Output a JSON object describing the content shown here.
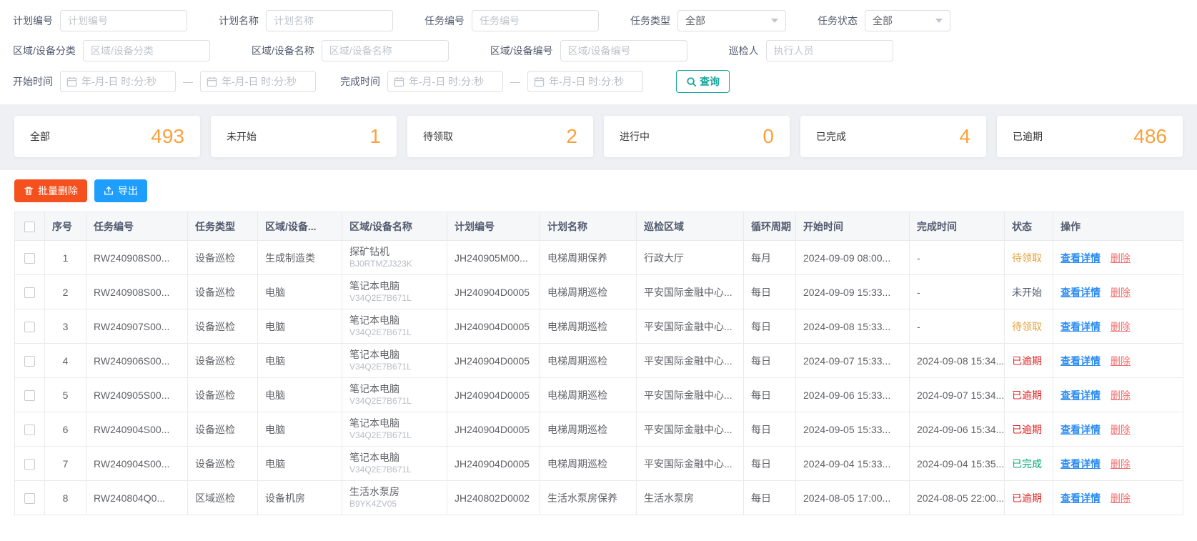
{
  "filters": {
    "plan_no": {
      "label": "计划编号",
      "placeholder": "计划编号"
    },
    "plan_name": {
      "label": "计划名称",
      "placeholder": "计划名称"
    },
    "task_no": {
      "label": "任务编号",
      "placeholder": "任务编号"
    },
    "task_type": {
      "label": "任务类型",
      "value": "全部"
    },
    "task_status": {
      "label": "任务状态",
      "value": "全部"
    },
    "area_category": {
      "label": "区域/设备分类",
      "placeholder": "区域/设备分类"
    },
    "area_name": {
      "label": "区域/设备名称",
      "placeholder": "区域/设备名称"
    },
    "area_no": {
      "label": "区域/设备编号",
      "placeholder": "区域/设备编号"
    },
    "inspector": {
      "label": "巡检人",
      "placeholder": "执行人员"
    },
    "start_time_label": "开始时间",
    "finish_time_label": "完成时间",
    "datetime_placeholder": "年-月-日 时:分:秒",
    "range_separator": "—",
    "search_button": "查询"
  },
  "stats": {
    "cards": [
      {
        "label": "全部",
        "value": "493"
      },
      {
        "label": "未开始",
        "value": "1"
      },
      {
        "label": "待领取",
        "value": "2"
      },
      {
        "label": "进行中",
        "value": "0"
      },
      {
        "label": "已完成",
        "value": "4"
      },
      {
        "label": "已逾期",
        "value": "486"
      }
    ]
  },
  "toolbar": {
    "batch_delete": "批量删除",
    "export": "导出"
  },
  "table": {
    "headers": [
      "序号",
      "任务编号",
      "任务类型",
      "区域/设备...",
      "区域/设备名称",
      "计划编号",
      "计划名称",
      "巡检区域",
      "循环周期",
      "开始时间",
      "完成时间",
      "状态",
      "操作"
    ],
    "action_view": "查看详情",
    "action_delete": "删除",
    "rows": [
      {
        "seq": "1",
        "task_no": "RW240908S00...",
        "task_type": "设备巡检",
        "device_category": "生成制造类",
        "device_name": "探矿钻机",
        "device_code": "BJ0RTMZJ323K",
        "plan_no": "JH240905M00...",
        "plan_name": "电梯周期保养",
        "area": "行政大厅",
        "cycle": "每月",
        "start": "2024-09-09 08:00...",
        "finish": "-",
        "status": "待领取",
        "status_class": "st-pending"
      },
      {
        "seq": "2",
        "task_no": "RW240908S00...",
        "task_type": "设备巡检",
        "device_category": "电脑",
        "device_name": "笔记本电脑",
        "device_code": "V34Q2E7B671L",
        "plan_no": "JH240904D0005",
        "plan_name": "电梯周期巡检",
        "area": "平安国际金融中心...",
        "cycle": "每日",
        "start": "2024-09-09 15:33...",
        "finish": "-",
        "status": "未开始",
        "status_class": "st-notstart"
      },
      {
        "seq": "3",
        "task_no": "RW240907S00...",
        "task_type": "设备巡检",
        "device_category": "电脑",
        "device_name": "笔记本电脑",
        "device_code": "V34Q2E7B671L",
        "plan_no": "JH240904D0005",
        "plan_name": "电梯周期巡检",
        "area": "平安国际金融中心...",
        "cycle": "每日",
        "start": "2024-09-08 15:33...",
        "finish": "-",
        "status": "待领取",
        "status_class": "st-pending"
      },
      {
        "seq": "4",
        "task_no": "RW240906S00...",
        "task_type": "设备巡检",
        "device_category": "电脑",
        "device_name": "笔记本电脑",
        "device_code": "V34Q2E7B671L",
        "plan_no": "JH240904D0005",
        "plan_name": "电梯周期巡检",
        "area": "平安国际金融中心...",
        "cycle": "每日",
        "start": "2024-09-07 15:33...",
        "finish": "2024-09-08 15:34...",
        "status": "已逾期",
        "status_class": "st-overdue"
      },
      {
        "seq": "5",
        "task_no": "RW240905S00...",
        "task_type": "设备巡检",
        "device_category": "电脑",
        "device_name": "笔记本电脑",
        "device_code": "V34Q2E7B671L",
        "plan_no": "JH240904D0005",
        "plan_name": "电梯周期巡检",
        "area": "平安国际金融中心...",
        "cycle": "每日",
        "start": "2024-09-06 15:33...",
        "finish": "2024-09-07 15:34...",
        "status": "已逾期",
        "status_class": "st-overdue"
      },
      {
        "seq": "6",
        "task_no": "RW240904S00...",
        "task_type": "设备巡检",
        "device_category": "电脑",
        "device_name": "笔记本电脑",
        "device_code": "V34Q2E7B671L",
        "plan_no": "JH240904D0005",
        "plan_name": "电梯周期巡检",
        "area": "平安国际金融中心...",
        "cycle": "每日",
        "start": "2024-09-05 15:33...",
        "finish": "2024-09-06 15:34...",
        "status": "已逾期",
        "status_class": "st-overdue"
      },
      {
        "seq": "7",
        "task_no": "RW240904S00...",
        "task_type": "设备巡检",
        "device_category": "电脑",
        "device_name": "笔记本电脑",
        "device_code": "V34Q2E7B671L",
        "plan_no": "JH240904D0005",
        "plan_name": "电梯周期巡检",
        "area": "平安国际金融中心...",
        "cycle": "每日",
        "start": "2024-09-04 15:33...",
        "finish": "2024-09-04 15:35...",
        "status": "已完成",
        "status_class": "st-done"
      },
      {
        "seq": "8",
        "task_no": "RW240804Q0...",
        "task_type": "区域巡检",
        "device_category": "设备机房",
        "device_name": "生活水泵房",
        "device_code": "B9YK4ZV05",
        "plan_no": "JH240802D0002",
        "plan_name": "生活水泵房保养",
        "area": "生活水泵房",
        "cycle": "每日",
        "start": "2024-08-05 17:00...",
        "finish": "2024-08-05 22:00...",
        "status": "已逾期",
        "status_class": "st-overdue"
      }
    ]
  },
  "colors": {
    "accent_teal": "#12a59a",
    "danger_button": "#f4511e",
    "primary_button": "#1e9fff",
    "stat_number": "#f9a23c",
    "status_pending": "#e6a23c",
    "status_overdue": "#e02020",
    "status_done": "#00a76f",
    "link_view": "#2d8cf0",
    "link_delete": "#f56c6c"
  }
}
